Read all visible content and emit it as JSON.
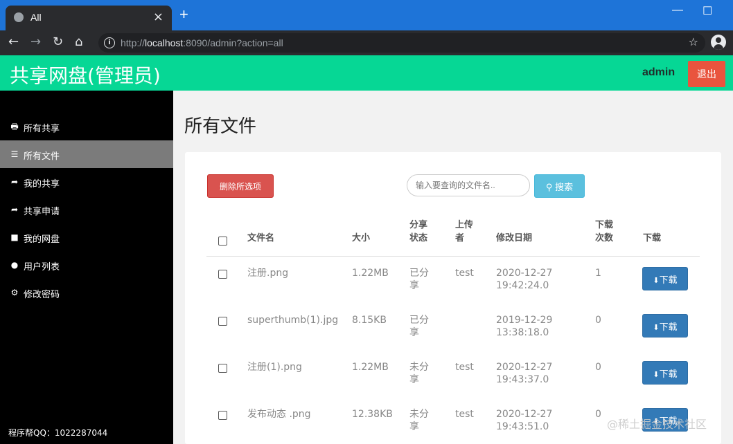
{
  "browser": {
    "tab_title": "All",
    "new_tab": "+",
    "url_prefix": "http://",
    "url_host": "localhost",
    "url_rest": ":8090/admin?action=all"
  },
  "header": {
    "title": "共享网盘(管理员)",
    "user": "admin",
    "logout_label": "退出"
  },
  "sidebar": {
    "items": [
      {
        "label": "所有共享",
        "icon": "printer-icon"
      },
      {
        "label": "所有文件",
        "icon": "list-icon",
        "active": true
      },
      {
        "label": "我的共享",
        "icon": "share-icon"
      },
      {
        "label": "共享申请",
        "icon": "share-icon"
      },
      {
        "label": "我的网盘",
        "icon": "folder-icon"
      },
      {
        "label": "用户列表",
        "icon": "user-icon"
      },
      {
        "label": "修改密码",
        "icon": "gear-icon"
      }
    ],
    "footer": "程序帮QQ：1022287044"
  },
  "main": {
    "title": "所有文件",
    "delete_label": "删除所选项",
    "search_placeholder": "输入要查询的文件名..",
    "search_label": "搜索",
    "columns": {
      "name": "文件名",
      "size": "大小",
      "share_1": "分享",
      "share_2": "状态",
      "uploader_1": "上传",
      "uploader_2": "者",
      "date": "修改日期",
      "count_1": "下载",
      "count_2": "次数",
      "download": "下载"
    },
    "rows": [
      {
        "name": "注册.png",
        "size": "1.22MB",
        "status_1": "已分",
        "status_2": "享",
        "uploader": "test",
        "date_1": "2020-12-27",
        "date_2": "19:42:24.0",
        "count": "1",
        "download": "下载"
      },
      {
        "name": "superthumb(1).jpg",
        "size": "8.15KB",
        "status_1": "已分",
        "status_2": "享",
        "uploader": "",
        "date_1": "2019-12-29",
        "date_2": "13:38:18.0",
        "count": "0",
        "download": "下载"
      },
      {
        "name": "注册(1).png",
        "size": "1.22MB",
        "status_1": "未分",
        "status_2": "享",
        "uploader": "test",
        "date_1": "2020-12-27",
        "date_2": "19:43:37.0",
        "count": "0",
        "download": "下载"
      },
      {
        "name": "发布动态 .png",
        "size": "12.38KB",
        "status_1": "未分",
        "status_2": "享",
        "uploader": "test",
        "date_1": "2020-12-27",
        "date_2": "19:43:51.0",
        "count": "0",
        "download": "下载"
      }
    ]
  },
  "watermark": "@稀土掘金技术社区",
  "colors": {
    "header_bg": "#06d795",
    "logout_bg": "#e9543e",
    "delete_bg": "#d9534f",
    "search_bg": "#5bc0de",
    "download_bg": "#337ab7",
    "sidebar_bg": "#000000",
    "sidebar_active": "#7b7b7b"
  }
}
